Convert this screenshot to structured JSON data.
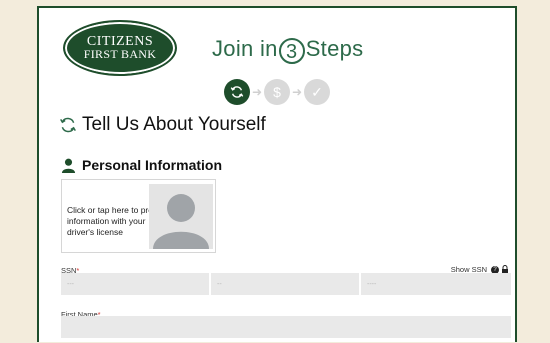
{
  "logo": {
    "line1": "CITIZENS",
    "line2": "FIRST BANK"
  },
  "header": {
    "title_pre": "Join in",
    "title_num": "3",
    "title_post": "Steps"
  },
  "steps": [
    {
      "icon": "refresh-icon",
      "state": "active"
    },
    {
      "icon": "dollar-icon",
      "state": "inactive"
    },
    {
      "icon": "check-icon",
      "state": "inactive"
    }
  ],
  "section": {
    "title": "Tell Us About Yourself",
    "icon": "refresh-icon"
  },
  "personal": {
    "title": "Personal Information",
    "icon": "person-icon"
  },
  "license": {
    "text": "Click or tap here to pre-fill information with your driver's license"
  },
  "ssn": {
    "label": "SSN",
    "required_mark": "*",
    "show_label": "Show SSN",
    "placeholders": [
      "---",
      "--",
      "----"
    ]
  },
  "first_name": {
    "label": "First Name",
    "required_mark": "*",
    "value": ""
  },
  "colors": {
    "brand": "#1e4d2b",
    "accent": "#2d6a4a",
    "required": "#d0312d",
    "inactive": "#d9d9d9"
  }
}
